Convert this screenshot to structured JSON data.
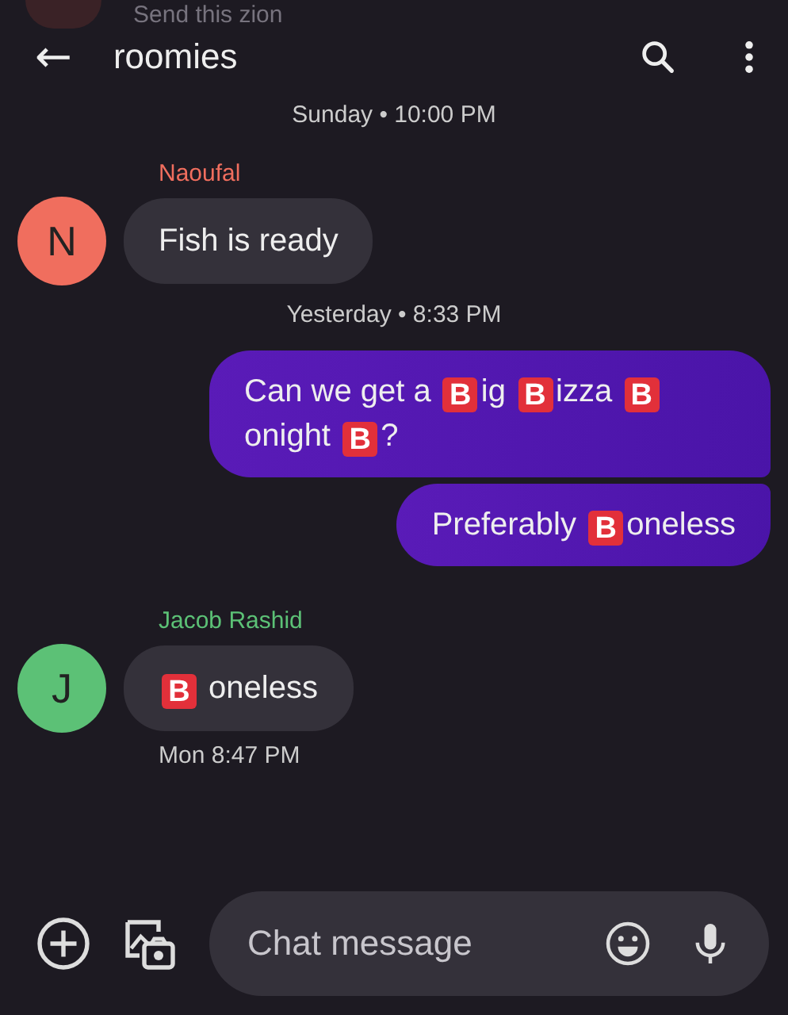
{
  "previous_message": {
    "text": "Send this zion"
  },
  "header": {
    "back": "←",
    "title": "roomies"
  },
  "items": [
    {
      "kind": "time",
      "text": "Sunday • 10:00 PM"
    },
    {
      "kind": "incoming",
      "sender": "Naoufal",
      "initial": "N",
      "color": "#f06e5e",
      "parts": [
        {
          "kind": "text",
          "text": "Fish is ready"
        }
      ]
    },
    {
      "kind": "time",
      "text": "Yesterday • 8:33 PM"
    },
    {
      "kind": "outgoing",
      "parts": [
        {
          "kind": "text",
          "text": "Can we get a "
        },
        {
          "kind": "badge",
          "text": "B"
        },
        {
          "kind": "text",
          "text": "ig "
        },
        {
          "kind": "badge",
          "text": "B"
        },
        {
          "kind": "text",
          "text": "izza "
        },
        {
          "kind": "badge",
          "text": "B"
        },
        {
          "kind": "text",
          "text": " onight "
        },
        {
          "kind": "badge",
          "text": "B"
        },
        {
          "kind": "text",
          "text": "?"
        }
      ]
    },
    {
      "kind": "outgoing",
      "parts": [
        {
          "kind": "text",
          "text": "Preferably "
        },
        {
          "kind": "badge",
          "text": "B"
        },
        {
          "kind": "text",
          "text": "oneless"
        }
      ]
    },
    {
      "kind": "incoming",
      "sender": "Jacob Rashid",
      "initial": "J",
      "color": "#5cc176",
      "parts": [
        {
          "kind": "badge",
          "text": "B"
        },
        {
          "kind": "text",
          "text": " oneless"
        }
      ],
      "time": "Mon 8:47 PM"
    }
  ],
  "composer": {
    "placeholder": "Chat message"
  }
}
